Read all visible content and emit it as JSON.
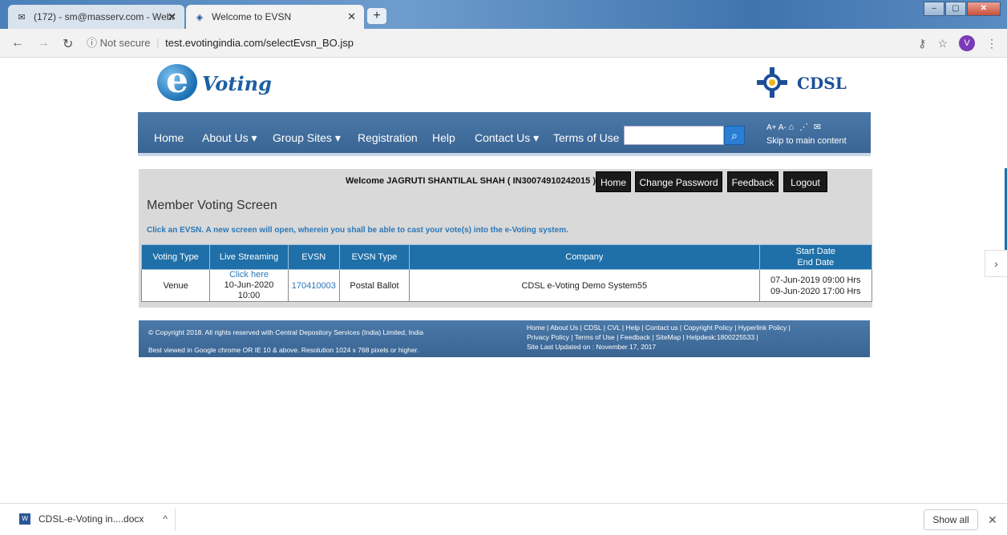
{
  "browser": {
    "tabs": [
      {
        "title": "(172) - sm@masserv.com - Webr",
        "icon": "mail-icon"
      },
      {
        "title": "Welcome to EVSN",
        "icon": "diamond-icon"
      }
    ],
    "new_tab": "+",
    "security_label": "Not secure",
    "url": "test.evotingindia.com/selectEvsn_BO.jsp",
    "avatar_letter": "V"
  },
  "header": {
    "logo_text": "Voting",
    "logo_letter": "e",
    "cdsl_text": "CDSL"
  },
  "nav": {
    "items": [
      "Home",
      "About Us ▾",
      "Group Sites ▾",
      "Registration",
      "Help",
      "Contact Us ▾",
      "Terms of Use"
    ],
    "search_placeholder": "",
    "accessibility": "A+ A-",
    "skip_link": "Skip to main content"
  },
  "session": {
    "welcome": "Welcome JAGRUTI SHANTILAL SHAH ( IN30074910242015 )",
    "buttons": [
      "Home",
      "Change Password",
      "Feedback",
      "Logout"
    ]
  },
  "main": {
    "title": "Member Voting Screen",
    "instruction": "Click an EVSN. A new screen will open, wherein you shall be able to cast your vote(s) into the e-Voting system.",
    "table": {
      "headers": [
        "Voting Type",
        "Live Streaming",
        "EVSN",
        "EVSN Type",
        "Company",
        "Start Date",
        "End Date"
      ],
      "rows": [
        {
          "voting_type": "Venue",
          "live_link": "Click here",
          "live_time": "10-Jun-2020 10:00",
          "evsn": "170410003",
          "evsn_type": "Postal Ballot",
          "company": "CDSL e-Voting Demo System55",
          "start": "07-Jun-2019 09:00 Hrs",
          "end": "09-Jun-2020 17:00 Hrs"
        }
      ]
    }
  },
  "footer": {
    "copyright": "© Copyright 2018. All rights reserved with Central Depository Services (India) Limited, India",
    "best_viewed": "Best viewed in Google chrome OR IE 10 & above. Resolution 1024 x 768 pixels or higher.",
    "links_1": "Home | About Us | CDSL | CVL | Help | Contact us | Copyright Policy | Hyperlink Policy |",
    "links_2": "Privacy Policy | Terms of Use | Feedback | SiteMap | Helpdesk:1800225533 |",
    "updated": "Site Last Updated on : November 17, 2017"
  },
  "downloads": {
    "file": "CDSL-e-Voting in....docx",
    "show_all": "Show all"
  }
}
